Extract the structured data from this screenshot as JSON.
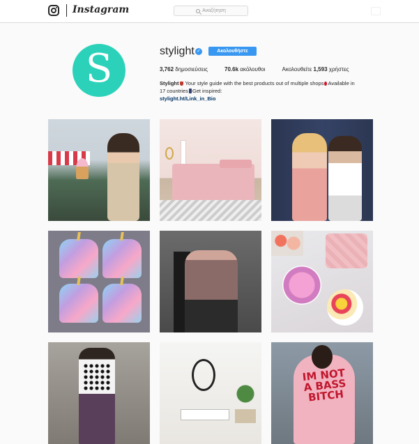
{
  "header": {
    "wordmark": "Instagram",
    "search_placeholder": "Αναζήτηση"
  },
  "profile": {
    "avatar_letter": "S",
    "avatar_color": "#2bd2b9",
    "username": "stylight",
    "verified": true,
    "follow_label": "Ακολουθήστε",
    "stats": {
      "posts_count": "3,762",
      "posts_label": "δημοσιεύσεις",
      "followers_count": "70.6k",
      "followers_label": "ακόλουθοι",
      "following_prefix": "Ακολουθείτε",
      "following_count": "1,593",
      "following_label": "χρήστες"
    },
    "bio": {
      "name": "Stylight",
      "line1": "Your style guide with the best products out of multiple shops",
      "line1b": "Available in",
      "line2a": "17 countries",
      "line2b": "Get inspired:",
      "link": "stylight.ht/Link_in_Bio"
    }
  },
  "posts": {
    "p9_text": "IM NOT A BASS BITCH"
  },
  "colors": {
    "accent": "#3897f0",
    "border": "#dbdbdb",
    "background": "#fafafa"
  }
}
